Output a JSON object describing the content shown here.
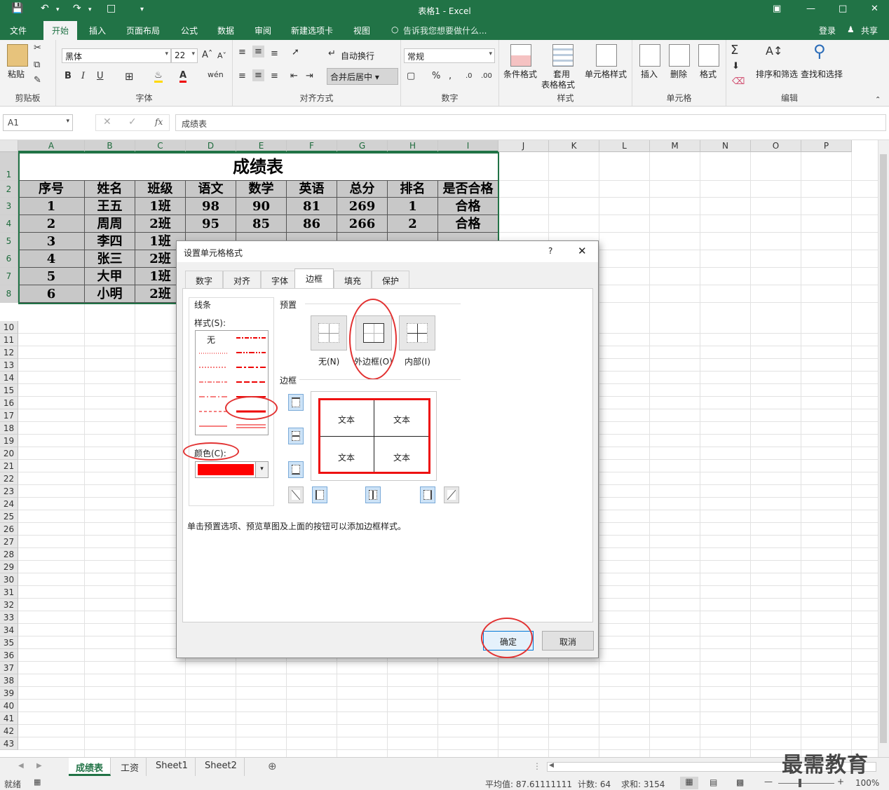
{
  "app": {
    "window_title": "表格1 - Excel",
    "login": "登录",
    "share": "共享"
  },
  "tabs": [
    "文件",
    "开始",
    "插入",
    "页面布局",
    "公式",
    "数据",
    "审阅",
    "新建选项卡",
    "视图"
  ],
  "tell_me": "告诉我您想要做什么...",
  "ribbon": {
    "clipboard": {
      "label": "剪贴板",
      "paste": "粘贴"
    },
    "font": {
      "label": "字体",
      "name": "黑体",
      "size": "22",
      "bold": "B",
      "italic": "I",
      "underline": "U"
    },
    "alignment": {
      "label": "对齐方式",
      "wrap": "自动换行",
      "merge": "合并后居中"
    },
    "number": {
      "label": "数字",
      "format": "常规"
    },
    "styles": {
      "label": "样式",
      "conditional": "条件格式",
      "table_format_1": "套用",
      "table_format_2": "表格格式",
      "cell_styles": "单元格样式"
    },
    "cells": {
      "label": "单元格",
      "insert": "插入",
      "delete": "删除",
      "format": "格式"
    },
    "editing": {
      "label": "编辑",
      "sort": "排序和筛选",
      "find": "查找和选择"
    }
  },
  "formula_bar": {
    "name_box": "A1",
    "fx": "fx",
    "content": "成绩表"
  },
  "columns": [
    "A",
    "B",
    "C",
    "D",
    "E",
    "F",
    "G",
    "H",
    "I",
    "J",
    "K",
    "L",
    "M",
    "N",
    "O",
    "P"
  ],
  "rows": [
    "1",
    "2",
    "3",
    "4",
    "5",
    "6",
    "7",
    "8",
    "10",
    "11",
    "12",
    "13",
    "14",
    "15",
    "16",
    "17",
    "18",
    "19",
    "20",
    "21",
    "22",
    "23",
    "24",
    "25",
    "26",
    "27",
    "28",
    "29",
    "30",
    "31",
    "32",
    "33",
    "34",
    "35",
    "36",
    "37",
    "38",
    "39",
    "40",
    "41",
    "42",
    "43"
  ],
  "sheet": {
    "title": "成绩表",
    "headers": [
      "序号",
      "姓名",
      "班级",
      "语文",
      "数学",
      "英语",
      "总分",
      "排名",
      "是否合格"
    ],
    "data": [
      [
        "1",
        "王五",
        "1班",
        "98",
        "90",
        "81",
        "269",
        "1",
        "合格"
      ],
      [
        "2",
        "周周",
        "2班",
        "95",
        "85",
        "86",
        "266",
        "2",
        "合格"
      ],
      [
        "3",
        "李四",
        "1班",
        "",
        "",
        "",
        "",
        "",
        ""
      ],
      [
        "4",
        "张三",
        "2班",
        "",
        "",
        "",
        "",
        "",
        ""
      ],
      [
        "5",
        "大甲",
        "1班",
        "",
        "",
        "",
        "",
        "",
        ""
      ],
      [
        "6",
        "小明",
        "2班",
        "",
        "",
        "",
        "",
        "",
        ""
      ]
    ]
  },
  "dialog": {
    "title": "设置单元格格式",
    "help": "?",
    "tabs": [
      "数字",
      "对齐",
      "字体",
      "边框",
      "填充",
      "保护"
    ],
    "active_tab": "边框",
    "line_section": "线条",
    "style_label": "样式(S):",
    "none_style": "无",
    "color_label": "颜色(C):",
    "color_value": "#ff0000",
    "presets_label": "预置",
    "presets": [
      "无(N)",
      "外边框(O)",
      "内部(I)"
    ],
    "border_label": "边框",
    "preview_text": "文本",
    "hint": "单击预置选项、预览草图及上面的按钮可以添加边框样式。",
    "ok": "确定",
    "cancel": "取消"
  },
  "sheets": [
    "成绩表",
    "工资",
    "Sheet1",
    "Sheet2"
  ],
  "status": {
    "ready": "就绪",
    "average": "平均值: 87.61111111",
    "count": "计数: 64",
    "sum": "求和: 3154",
    "zoom": "100%"
  },
  "watermark": "最需教育"
}
